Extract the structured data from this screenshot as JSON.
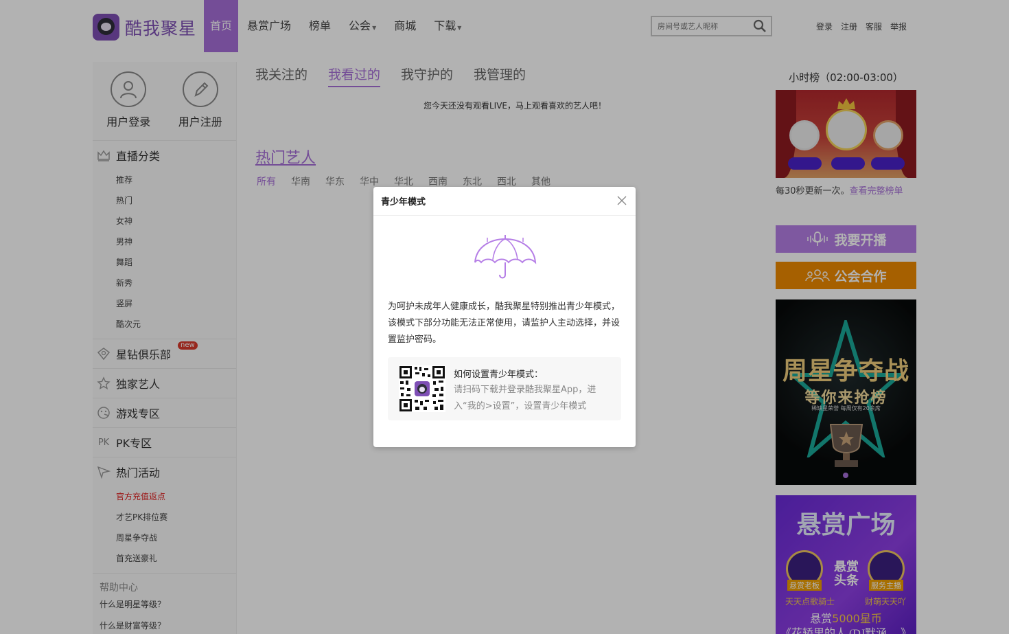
{
  "header": {
    "logo_text": "酷我聚星",
    "nav": [
      {
        "label": "首页",
        "active": true,
        "dropdown": false
      },
      {
        "label": "悬赏广场",
        "active": false,
        "dropdown": false
      },
      {
        "label": "榜单",
        "active": false,
        "dropdown": false
      },
      {
        "label": "公会",
        "active": false,
        "dropdown": true
      },
      {
        "label": "商城",
        "active": false,
        "dropdown": false
      },
      {
        "label": "下载",
        "active": false,
        "dropdown": true
      }
    ],
    "search_placeholder": "房间号或艺人昵称",
    "links": [
      "登录",
      "注册",
      "客服",
      "举报"
    ]
  },
  "sidebar": {
    "login_label": "用户登录",
    "register_label": "用户注册",
    "live_category": {
      "title": "直播分类",
      "items": [
        "推荐",
        "热门",
        "女神",
        "男神",
        "舞蹈",
        "新秀",
        "竖屏",
        "酷次元"
      ]
    },
    "star_club": {
      "title": "星钻俱乐部",
      "badge": "new"
    },
    "exclusive": "独家艺人",
    "games": "游戏专区",
    "pk": {
      "icon_text": "PK",
      "title": "PK专区"
    },
    "activities": {
      "title": "热门活动",
      "items": [
        "官方充值返点",
        "才艺PK排位赛",
        "周星争夺战",
        "首充送豪礼"
      ]
    },
    "help": {
      "title": "帮助中心",
      "items": [
        "什么是明星等级？",
        "什么是财富等级？"
      ]
    }
  },
  "main": {
    "tabs": [
      {
        "label": "我关注的",
        "active": false
      },
      {
        "label": "我看过的",
        "active": true
      },
      {
        "label": "我守护的",
        "active": false
      },
      {
        "label": "我管理的",
        "active": false
      }
    ],
    "empty_tip": "您今天还没有观看LIVE，马上观看喜欢的艺人吧！",
    "hot_title": "热门艺人",
    "regions": [
      {
        "label": "所有",
        "active": true
      },
      {
        "label": "华南",
        "active": false
      },
      {
        "label": "华东",
        "active": false
      },
      {
        "label": "华中",
        "active": false
      },
      {
        "label": "华北",
        "active": false
      },
      {
        "label": "西南",
        "active": false
      },
      {
        "label": "东北",
        "active": false
      },
      {
        "label": "西北",
        "active": false
      },
      {
        "label": "其他",
        "active": false
      }
    ]
  },
  "right": {
    "rank_title": "小时榜（02:00-03:00）",
    "rank_note": "每30秒更新一次。",
    "rank_link": "查看完整榜单",
    "live_button": "我要开播",
    "guild_button": "公会合作",
    "banner1": {
      "title": "周星争夺战",
      "subtitle": "等你来抢榜",
      "small": "稀缺星荣誉 每周仅有20余席"
    },
    "banner2": {
      "title": "悬赏广场",
      "headline": "悬赏\n头条",
      "left_tag": "悬赏老板",
      "right_tag": "服务主播",
      "left_name": "天天点歌骑士",
      "right_name": "财萌天天吖",
      "line1_prefix": "悬赏",
      "line1_amount": "5000星币",
      "line2": "《花轿里的人 (DJ默涵… 》"
    }
  },
  "modal": {
    "title": "青少年模式",
    "body": "为呵护未成年人健康成长，酷我聚星特别推出青少年模式，该模式下部分功能无法正常使用，请监护人主动选择，并设置监护密码。",
    "qr_title": "如何设置青少年模式：",
    "qr_desc": "请扫码下载并登录酷我聚星App，进入“我的>设置”，设置青少年模式"
  },
  "colors": {
    "accent": "#a66fd8",
    "guild_orange": "#ee8a00",
    "alert_red": "#e02020"
  }
}
